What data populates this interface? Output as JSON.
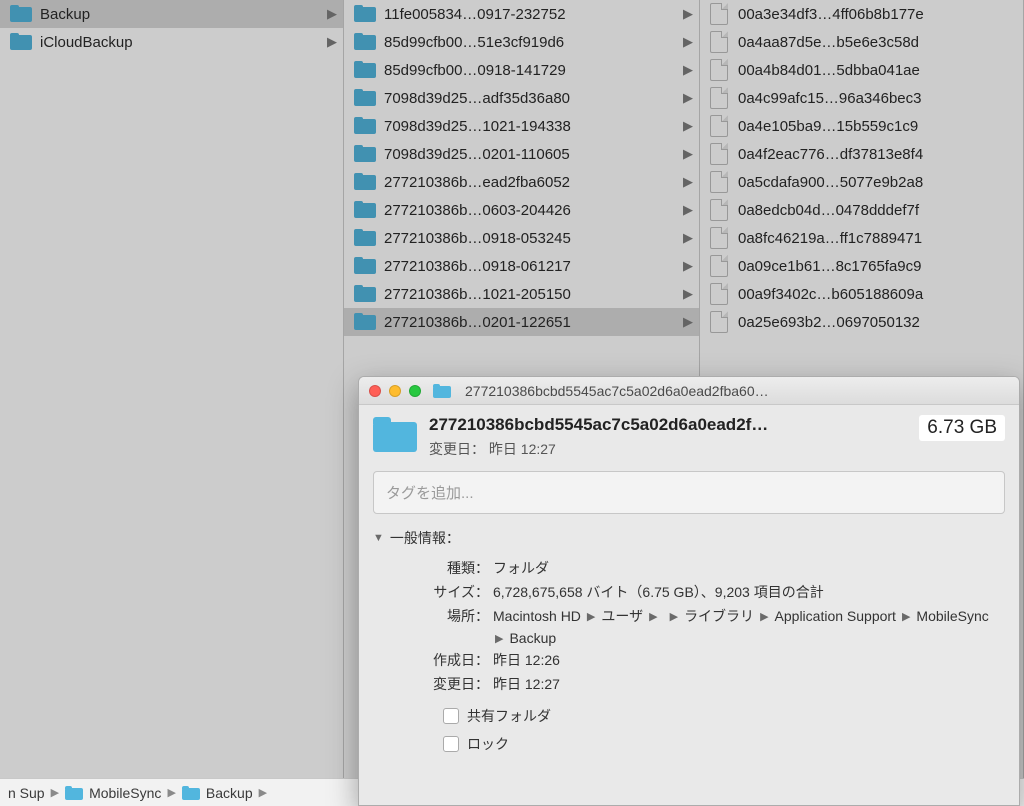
{
  "finder": {
    "col1": [
      {
        "name": "Backup",
        "type": "folder",
        "hasChildren": true,
        "selected": true
      },
      {
        "name": "iCloudBackup",
        "type": "folder",
        "hasChildren": true,
        "selected": false
      }
    ],
    "col2": [
      {
        "name": "11fe005834…0917-232752",
        "type": "folder",
        "hasChildren": true,
        "selected": false
      },
      {
        "name": "85d99cfb00…51e3cf919d6",
        "type": "folder",
        "hasChildren": true,
        "selected": false
      },
      {
        "name": "85d99cfb00…0918-141729",
        "type": "folder",
        "hasChildren": true,
        "selected": false
      },
      {
        "name": "7098d39d25…adf35d36a80",
        "type": "folder",
        "hasChildren": true,
        "selected": false
      },
      {
        "name": "7098d39d25…1021-194338",
        "type": "folder",
        "hasChildren": true,
        "selected": false
      },
      {
        "name": "7098d39d25…0201-110605",
        "type": "folder",
        "hasChildren": true,
        "selected": false
      },
      {
        "name": "277210386b…ead2fba6052",
        "type": "folder",
        "hasChildren": true,
        "selected": false
      },
      {
        "name": "277210386b…0603-204426",
        "type": "folder",
        "hasChildren": true,
        "selected": false
      },
      {
        "name": "277210386b…0918-053245",
        "type": "folder",
        "hasChildren": true,
        "selected": false
      },
      {
        "name": "277210386b…0918-061217",
        "type": "folder",
        "hasChildren": true,
        "selected": false
      },
      {
        "name": "277210386b…1021-205150",
        "type": "folder",
        "hasChildren": true,
        "selected": false
      },
      {
        "name": "277210386b…0201-122651",
        "type": "folder",
        "hasChildren": true,
        "selected": true
      }
    ],
    "col3": [
      {
        "name": "00a3e34df3…4ff06b8b177e",
        "type": "file"
      },
      {
        "name": "0a4aa87d5e…b5e6e3c58d",
        "type": "file"
      },
      {
        "name": "00a4b84d01…5dbba041ae",
        "type": "file"
      },
      {
        "name": "0a4c99afc15…96a346bec3",
        "type": "file"
      },
      {
        "name": "0a4e105ba9…15b559c1c9",
        "type": "file"
      },
      {
        "name": "0a4f2eac776…df37813e8f4",
        "type": "file"
      },
      {
        "name": "0a5cdafa900…5077e9b2a8",
        "type": "file"
      },
      {
        "name": "0a8edcb04d…0478dddef7f",
        "type": "file"
      },
      {
        "name": "0a8fc46219a…ff1c7889471",
        "type": "file"
      },
      {
        "name": "0a09ce1b61…8c1765fa9c9",
        "type": "file"
      },
      {
        "name": "00a9f3402c…b605188609a",
        "type": "file"
      },
      {
        "name": "0a25e693b2…0697050132",
        "type": "file"
      }
    ]
  },
  "pathbar": {
    "seg1_truncated": "n Sup",
    "seg2": "MobileSync",
    "seg3": "Backup"
  },
  "info": {
    "window_title": "277210386bcbd5545ac7c5a02d6a0ead2fba60…",
    "header_name": "277210386bcbd5545ac7c5a02d6a0ead2f…",
    "modified_label": "変更日：",
    "modified_value": "昨日 12:27",
    "size_short": "6.73 GB",
    "tags_placeholder": "タグを追加...",
    "general_header": "一般情報：",
    "kind_label": "種類：",
    "kind_value": "フォルダ",
    "size_label": "サイズ：",
    "size_value": "6,728,675,658 バイト（6.75 GB）、9,203 項目の合計",
    "where_label": "場所：",
    "where_parts": [
      "Macintosh HD",
      "ユーザ",
      "",
      "ライブラリ",
      "Application Support",
      "MobileSync",
      "Backup"
    ],
    "created_label": "作成日：",
    "created_value": "昨日 12:26",
    "modified2_label": "変更日：",
    "modified2_value": "昨日 12:27",
    "shared_label": "共有フォルダ",
    "lock_label": "ロック"
  }
}
